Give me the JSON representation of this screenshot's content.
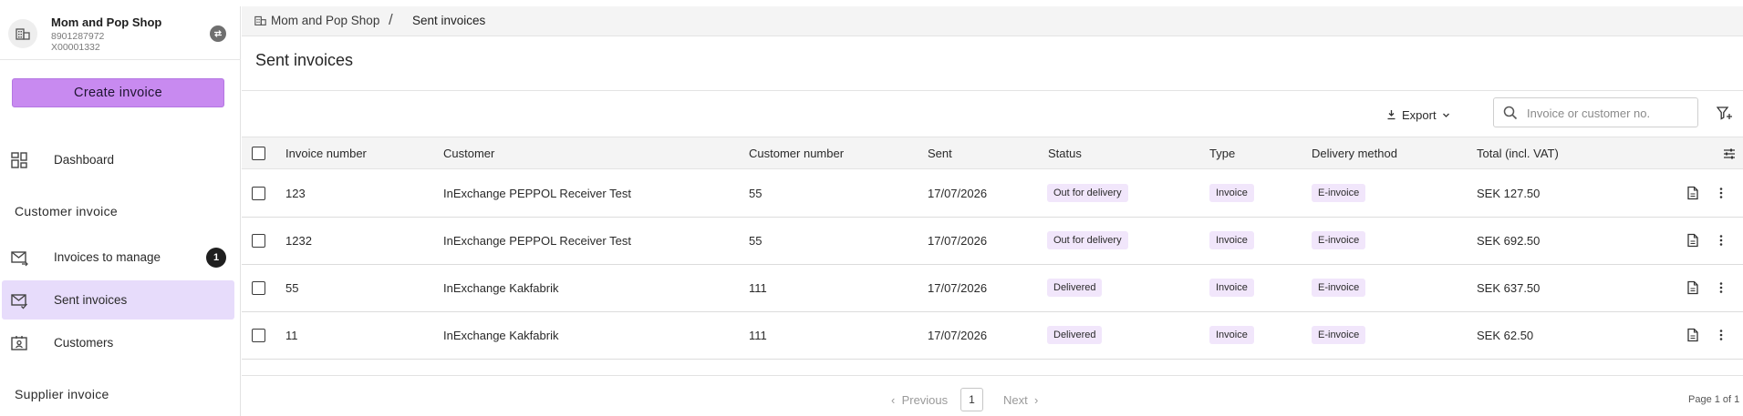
{
  "shop": {
    "name": "Mom and Pop Shop",
    "org_number": "8901287972",
    "customer_id": "X00001332"
  },
  "sidebar": {
    "create_button": "Create invoice",
    "dashboard": "Dashboard",
    "customer_section": "Customer invoice",
    "items": [
      {
        "label": "Invoices to manage",
        "badge": "1",
        "icon": "envelope-arrow-icon"
      },
      {
        "label": "Sent invoices",
        "icon": "envelope-check-icon",
        "active": true
      },
      {
        "label": "Customers",
        "icon": "contact-card-icon"
      }
    ],
    "supplier_section": "Supplier invoice"
  },
  "breadcrumb": {
    "home": "Mom and Pop Shop",
    "separator": "/",
    "current": "Sent invoices"
  },
  "page": {
    "title": "Sent invoices"
  },
  "toolbar": {
    "export_label": "Export",
    "search_placeholder": "Invoice or customer no."
  },
  "table": {
    "columns": [
      "Invoice number",
      "Customer",
      "Customer number",
      "Sent",
      "Status",
      "Type",
      "Delivery method",
      "Total (incl. VAT)"
    ],
    "rows": [
      {
        "invoice_number": "123",
        "customer": "InExchange PEPPOL Receiver Test",
        "customer_number": "55",
        "sent": "17/07/2026",
        "status": "Out for delivery",
        "type": "Invoice",
        "delivery": "E-invoice",
        "total": "SEK 127.50"
      },
      {
        "invoice_number": "1232",
        "customer": "InExchange PEPPOL Receiver Test",
        "customer_number": "55",
        "sent": "17/07/2026",
        "status": "Out for delivery",
        "type": "Invoice",
        "delivery": "E-invoice",
        "total": "SEK 692.50"
      },
      {
        "invoice_number": "55",
        "customer": "InExchange Kakfabrik",
        "customer_number": "111",
        "sent": "17/07/2026",
        "status": "Delivered",
        "type": "Invoice",
        "delivery": "E-invoice",
        "total": "SEK 637.50"
      },
      {
        "invoice_number": "11",
        "customer": "InExchange Kakfabrik",
        "customer_number": "111",
        "sent": "17/07/2026",
        "status": "Delivered",
        "type": "Invoice",
        "delivery": "E-invoice",
        "total": "SEK 62.50"
      }
    ]
  },
  "pagination": {
    "previous": "Previous",
    "current_page": "1",
    "next": "Next",
    "info": "Page 1 of 1"
  },
  "colors": {
    "accent": "#c88af0",
    "active_nav": "#e7dcfb",
    "pill_bg": "#f1e6fb"
  }
}
